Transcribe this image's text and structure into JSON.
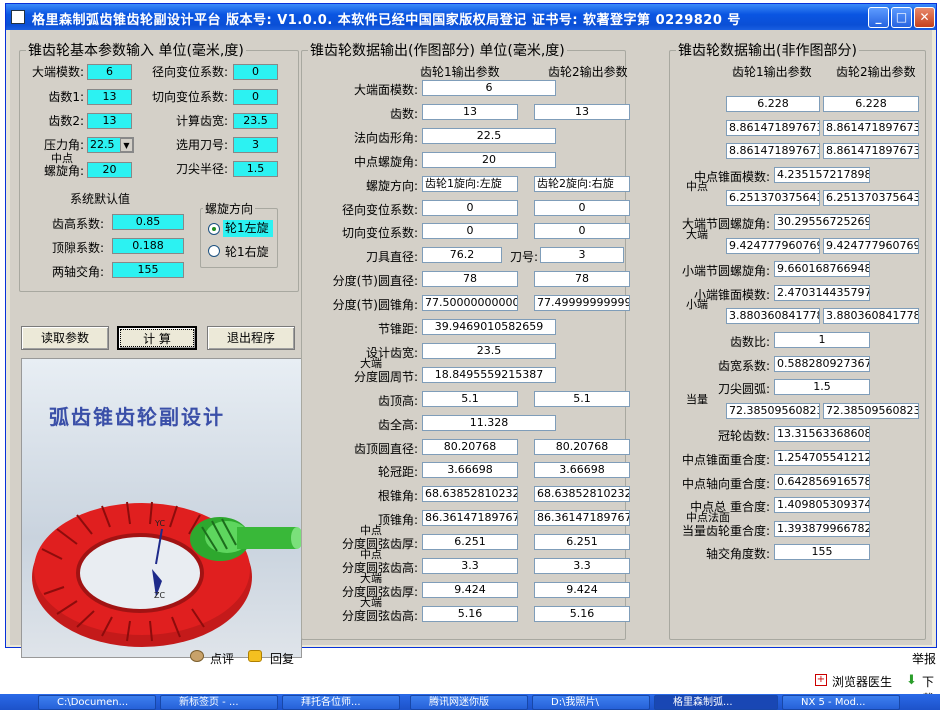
{
  "window": {
    "title": "格里森制弧齿锥齿轮副设计平台  版本号: V1.0.0.   本软件已经中国国家版权局登记   证书号: 软著登字第 0229820 号"
  },
  "basic": {
    "legend": "锥齿轮基本参数输入 单位(毫米,度)",
    "module_label": "大端模数:",
    "module": "6",
    "radial_shift_label": "径向变位系数:",
    "radial_shift": "0",
    "teeth1_label": "齿数1:",
    "teeth1": "13",
    "tangent_shift_label": "切向变位系数:",
    "tangent_shift": "0",
    "teeth2_label": "齿数2:",
    "teeth2": "13",
    "face_width_label": "计算齿宽:",
    "face_width": "23.5",
    "pressure_label": "压力角:",
    "pressure": "22.5",
    "cutter_no_label": "选用刀号:",
    "cutter_no": "3",
    "spiral_label_1": "中点",
    "spiral_label_2": "螺旋角:",
    "spiral": "20",
    "tip_radius_label": "刀尖半径:",
    "tip_radius": "1.5",
    "defaults_title": "系统默认值",
    "addendum_coef_label": "齿高系数:",
    "addendum_coef": "0.85",
    "clearance_coef_label": "顶隙系数:",
    "clearance_coef": "0.188",
    "shaft_angle_label": "两轴交角:",
    "shaft_angle": "155",
    "hand_legend": "螺旋方向",
    "hand_left": "轮1左旋",
    "hand_right": "轮1右旋"
  },
  "buttons": {
    "read": "读取参数",
    "calc": "计  算",
    "exit": "退出程序"
  },
  "banner": {
    "title": "弧齿锥齿轮副设计",
    "axis_y": "YC",
    "axis_z": "ZC"
  },
  "drawing": {
    "legend": "锥齿轮数据输出(作图部分) 单位(毫米,度)",
    "col1": "齿轮1输出参数",
    "col2": "齿轮2输出参数",
    "rows": [
      {
        "label": "大端面模数:",
        "v1": "6",
        "wide": true
      },
      {
        "label": "齿数:",
        "v1": "13",
        "v2": "13"
      },
      {
        "label": "法向齿形角:",
        "v1": "22.5",
        "wide": true
      },
      {
        "label": "中点螺旋角:",
        "v1": "20",
        "wide": true
      },
      {
        "label": "螺旋方向:",
        "v1": "齿轮1旋向:左旋",
        "v2": "齿轮2旋向:右旋",
        "leftalign": true
      },
      {
        "label": "径向变位系数:",
        "v1": "0",
        "v2": "0"
      },
      {
        "label": "切向变位系数:",
        "v1": "0",
        "v2": "0"
      },
      {
        "label": "刀具直径:",
        "v1": "76.2",
        "knife_label": "刀号:",
        "v2": "3"
      },
      {
        "label": "分度(节)圆直径:",
        "v1": "78",
        "v2": "78"
      },
      {
        "label": "分度(节)圆锥角:",
        "v1": "77.500000000000",
        "v2": "77.499999999999",
        "leftalign": true
      },
      {
        "label": "节锥距:",
        "v1": "39.9469010582659",
        "wide": true
      },
      {
        "label": "设计齿宽:",
        "v1": "23.5",
        "wide": true
      },
      {
        "label": "分度圆周节:",
        "top": "大端",
        "v1": "18.8495559215387",
        "wide": true
      },
      {
        "label": "齿顶高:",
        "v1": "5.1",
        "v2": "5.1"
      },
      {
        "label": "齿全高:",
        "v1": "11.328",
        "wide": true
      },
      {
        "label": "齿顶圆直径:",
        "v1": "80.20768",
        "v2": "80.20768"
      },
      {
        "label": "轮冠距:",
        "v1": "3.66698",
        "v2": "3.66698"
      },
      {
        "label": "根锥角:",
        "v1": "68.6385281023264",
        "v2": "68.6385281023264",
        "leftalign": true
      },
      {
        "label": "顶锥角:",
        "v1": "86.3614718976736",
        "v2": "86.3614718976736",
        "leftalign": true
      },
      {
        "label": "分度圆弦齿厚:",
        "top": "中点",
        "v1": "6.251",
        "v2": "6.251"
      },
      {
        "label": "分度圆弦齿高:",
        "top": "中点",
        "v1": "3.3",
        "v2": "3.3"
      },
      {
        "label": "分度圆弦齿厚:",
        "top": "大端",
        "v1": "9.424",
        "v2": "9.424"
      },
      {
        "label": "分度圆弦齿高:",
        "top": "大端",
        "v1": "5.16",
        "v2": "5.16"
      }
    ]
  },
  "nondrawing": {
    "legend": "锥齿轮数据输出(非作图部分)",
    "col1": "齿轮1输出参数",
    "col2": "齿轮2输出参数",
    "rows": [
      {
        "label": "齿根高:",
        "v1": "6.228",
        "v2": "6.228"
      },
      {
        "label": "齿顶角:",
        "v1": "8.86147189767340",
        "v2": "8.86147189767340",
        "leftalign": true
      },
      {
        "label": "齿根角:",
        "v1": "8.86147189767340",
        "v2": "8.86147189767340",
        "leftalign": true
      },
      {
        "label": "中点锥面模数:",
        "v1": "4.23515721789850",
        "wide": true
      },
      {
        "label": "弧齿厚:",
        "top": "中点",
        "v1": "6.25137037564320",
        "v2": "6.25137037564320",
        "leftalign": true
      },
      {
        "label": "大端节圆螺旋角:",
        "v1": "30.2955672526920",
        "wide": true
      },
      {
        "label": "弧齿厚:",
        "top": "大端",
        "v1": "9.42477796076930",
        "v2": "9.42477796076930",
        "leftalign": true
      },
      {
        "label": "小端节圆螺旋角:",
        "v1": "9.66016876694890",
        "wide": true
      },
      {
        "label": "小端锥面模数:",
        "v1": "2.47031443579710",
        "wide": true
      },
      {
        "label": "弧齿厚:",
        "top": "小端",
        "v1": "3.88036084177850",
        "v2": "3.88036084177850",
        "leftalign": true
      },
      {
        "label": "齿数比:",
        "v1": "1",
        "center": true
      },
      {
        "label": "齿宽系数:",
        "v1": "0.588280927367130",
        "center": true
      },
      {
        "label": "刀尖圆弧:",
        "v1": "1.5",
        "center": true
      },
      {
        "label": "齿数:",
        "top": "当量",
        "v1": "72.3850956082390",
        "v2": "72.3850956082390",
        "leftalign": true
      },
      {
        "label": "冠轮齿数:",
        "v1": "13.3156336860880",
        "center": true
      },
      {
        "label": "中点锥面重合度:",
        "v1": "1.25470554121200",
        "center": true
      },
      {
        "label": "中点轴向重合度:",
        "v1": "0.64285691657850",
        "center": true
      },
      {
        "label": "中点总 重合度:",
        "v1": "1.40980530937470",
        "center": true
      },
      {
        "label": "当量齿轮重合度:",
        "top": "中点法面",
        "v1": "1.39387996678210",
        "center": true
      },
      {
        "label": "轴交角度数:",
        "v1": "155",
        "center": true
      }
    ]
  },
  "below": {
    "comment": "点评",
    "reply": "回复",
    "report": "举报",
    "doctor": "浏览器医生",
    "download": "下载"
  },
  "taskbar": [
    "C:\\Documen...",
    "新标签页 - ...",
    "拜托各位师...",
    "腾讯网迷你版",
    "D:\\我照片\\",
    "格里森制弧...",
    "NX 5 - Mod..."
  ]
}
